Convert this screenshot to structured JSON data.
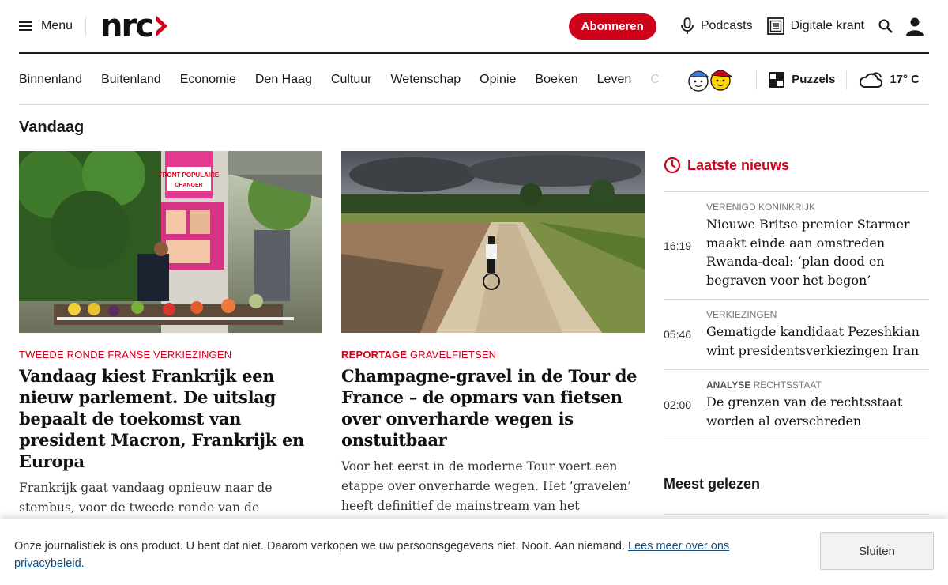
{
  "header": {
    "menu_label": "Menu",
    "logo_text": "nrc",
    "subscribe_label": "Abonneren",
    "podcasts_label": "Podcasts",
    "newspaper_label": "Digitale krant",
    "accent_color": "#d0021b"
  },
  "nav": {
    "sections": [
      "Binnenland",
      "Buitenland",
      "Economie",
      "Den Haag",
      "Cultuur",
      "Wetenschap",
      "Opinie",
      "Boeken",
      "Leven"
    ],
    "overflow_hint": "C",
    "puzzles_label": "Puzzels",
    "weather_temp": "17° C"
  },
  "main": {
    "section_title": "Vandaag",
    "articles": [
      {
        "kicker": "Tweede ronde Franse verkiezingen",
        "kicker_bold": "",
        "headline": "Vandaag kiest Frankrijk een nieuw parlement. De uitslag bepaalt de toekomst van president Macron, Frankrijk en Europa",
        "lede": "Frankrijk gaat vandaag opnieuw naar de stembus, voor de tweede ronde van de parlementsverkiezingen. Hoeveel macht heeft",
        "poster_text_1": "FRONT POPULAIRE",
        "poster_text_2": "CHANGER"
      },
      {
        "kicker_bold": "Reportage",
        "kicker": "Gravelfietsen",
        "headline": "Champagne-gravel in de Tour de France – de opmars van fietsen over onverharde wegen is onstuitbaar",
        "lede": "Voor het eerst in de moderne Tour voert een etappe over onverharde wegen. Het ‘gravelen’ heeft definitief de mainstream van het wielrennen bereikt."
      }
    ]
  },
  "latest": {
    "title": "Laatste nieuws",
    "items": [
      {
        "time": "16:19",
        "kicker_bold": "",
        "kicker": "Verenigd Koninkrijk",
        "title": "Nieuwe Britse premier Starmer maakt einde aan omstreden Rwanda-deal: ‘plan dood en begraven voor het begon’"
      },
      {
        "time": "05:46",
        "kicker_bold": "",
        "kicker": "Verkiezingen",
        "title": "Gematigde kandidaat Pezeshkian wint presidentsverkiezingen Iran"
      },
      {
        "time": "02:00",
        "kicker_bold": "Analyse",
        "kicker": "Rechtsstaat",
        "title": "De grenzen van de rechtsstaat worden al overschreden"
      }
    ],
    "most_read_title": "Meest gelezen"
  },
  "cookie": {
    "text": "Onze journalistiek is ons product. U bent dat niet. Daarom verkopen we uw persoonsgegevens niet. Nooit. Aan niemand.",
    "link_label": "Lees meer over ons privacybeleid.",
    "close_label": "Sluiten"
  }
}
